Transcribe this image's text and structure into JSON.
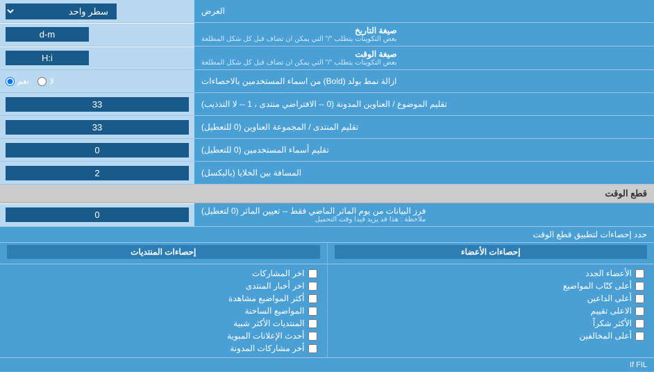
{
  "page": {
    "display_label": "العرض",
    "line_control_label": "سطر واحد",
    "date_format_label": "صيغة التاريخ",
    "date_format_sublabel": "بعض التكوينات يتطلب \"/\" التي يمكن ان تضاف قبل كل شكل المطلعة",
    "date_format_value": "d-m",
    "time_format_label": "صيغة الوقت",
    "time_format_sublabel": "بعض التكوينات يتطلب \"/\" التي يمكن ان تضاف قبل كل شكل المطلعة",
    "time_format_value": "H:i",
    "bold_label": "ازالة نمط بولد (Bold) من اسماء المستخدمين بالاحصاءات",
    "bold_yes": "نعم",
    "bold_no": "لا",
    "forum_order_label": "تقليم الموضوع / العناوين المدونة (0 -- الافتراضي منتدى ، 1 -- لا التذذيب)",
    "forum_order_value": "33",
    "forum_group_label": "تقليم المنتدى / المجموعة العناوين (0 للتعطيل)",
    "forum_group_value": "33",
    "usernames_label": "تقليم أسماء المستخدمين (0 للتعطيل)",
    "usernames_value": "0",
    "cell_spacing_label": "المسافة بين الخلايا (بالبكسل)",
    "cell_spacing_value": "2",
    "cutoff_section_label": "قطع الوقت",
    "cutoff_filter_label": "فرز البيانات من يوم الماثر الماضي فقط -- تعيين الماثر (0 لتعطيل)",
    "cutoff_filter_sublabel": "ملاحظة : هذا قد يزيد قيدا وقت التحميل",
    "cutoff_value": "0",
    "stats_limit_label": "حدد إحصاءات لتطبيق قطع الوقت",
    "stats_memberships_col": "إحصاءات المنتديات",
    "stats_members_col": "إحصاءات الأعضاء",
    "stats_items_memberships": [
      "اخر المشاركات",
      "اخر أخبار المنتدى",
      "أكثر المواضيع مشاهدة",
      "المواضيع الساخنة",
      "المنتديات الأكثر شبية",
      "أحدث الإعلانات المبوية",
      "أخر مشاركات المدونة"
    ],
    "stats_items_members": [
      "الأعضاء الجدد",
      "أعلى كتّاب المواضيع",
      "أعلى الداعين",
      "الاعلى تقييم",
      "الأكثر شكراً",
      "أعلى المخالفين"
    ]
  }
}
